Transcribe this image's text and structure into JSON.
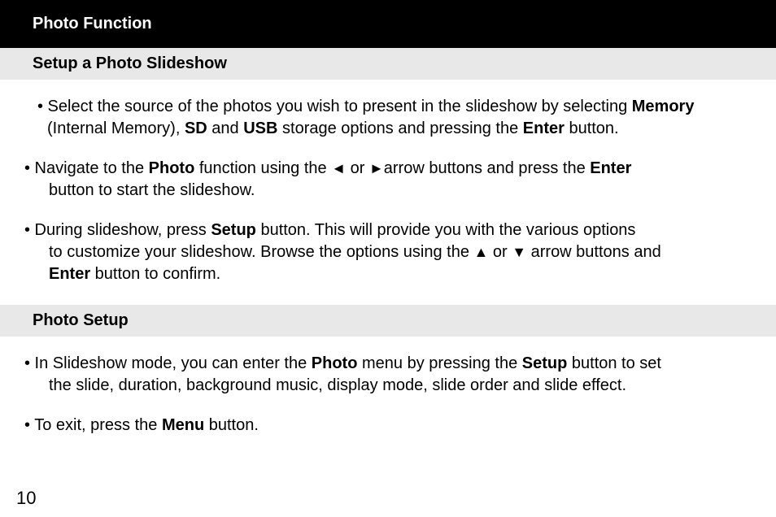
{
  "header": {
    "title": "Photo Function"
  },
  "sections": {
    "slideshow": {
      "heading": "Setup a Photo Slideshow",
      "bullet1_pre": "• Select the source of the photos you wish to present in the slideshow by selecting ",
      "bullet1_b1": "Memory",
      "bullet1_mid1": " (Internal Memory), ",
      "bullet1_b2": "SD",
      "bullet1_mid2": " and ",
      "bullet1_b3": "USB",
      "bullet1_mid3": " storage options and pressing the ",
      "bullet1_b4": "Enter",
      "bullet1_end": " button.",
      "bullet2_pre": "• Navigate to the ",
      "bullet2_b1": "Photo",
      "bullet2_mid1": " function using the ",
      "bullet2_arrow1": "◄",
      "bullet2_mid2": " or ",
      "bullet2_arrow2": "►",
      "bullet2_mid3": "arrow buttons and press the ",
      "bullet2_b2": "Enter",
      "bullet2_cont": "button to start the slideshow.",
      "bullet3_pre": "• During slideshow, press ",
      "bullet3_b1": "Setup",
      "bullet3_mid1": " button.  This will provide you with the various options",
      "bullet3_cont1": "to customize your slideshow.  Browse the options using the ",
      "bullet3_arrow1": "▲",
      "bullet3_mid2": " or ",
      "bullet3_arrow2": "▼",
      "bullet3_mid3": " arrow buttons and",
      "bullet3_b2": "Enter",
      "bullet3_end": " button to confirm."
    },
    "photosetup": {
      "heading": "Photo Setup",
      "bullet1_pre": "• In Slideshow mode, you can enter the ",
      "bullet1_b1": "Photo",
      "bullet1_mid1": " menu by pressing the ",
      "bullet1_b2": "Setup",
      "bullet1_mid2": " button to set",
      "bullet1_cont": "the slide, duration, background music, display mode, slide order and slide effect.",
      "bullet2_pre": "• To exit, press the ",
      "bullet2_b1": "Menu",
      "bullet2_end": " button."
    }
  },
  "page_number": "10"
}
